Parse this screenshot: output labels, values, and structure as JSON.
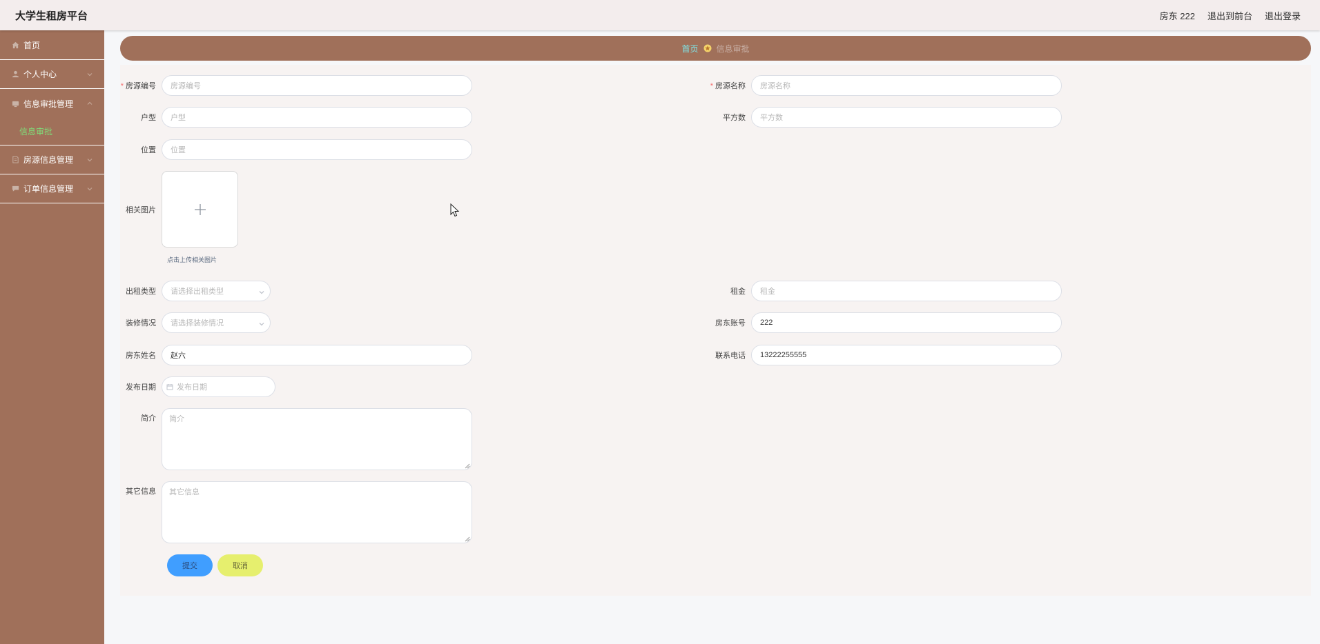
{
  "header": {
    "title": "大学生租房平台",
    "user_label": "房东 222",
    "to_front": "退出到前台",
    "logout": "退出登录"
  },
  "sidebar": {
    "items": [
      {
        "label": "首页",
        "icon": "home-icon"
      },
      {
        "label": "个人中心",
        "icon": "user-icon"
      },
      {
        "label": "信息审批管理",
        "icon": "monitor-icon",
        "expanded": true,
        "children": [
          {
            "label": "信息审批",
            "active": true
          }
        ]
      },
      {
        "label": "房源信息管理",
        "icon": "document-icon"
      },
      {
        "label": "订单信息管理",
        "icon": "chat-icon"
      }
    ]
  },
  "breadcrumb": {
    "home": "首页",
    "current": "信息审批"
  },
  "form": {
    "house_no": {
      "label": "房源编号",
      "placeholder": "房源编号",
      "required": true
    },
    "house_name": {
      "label": "房源名称",
      "placeholder": "房源名称",
      "required": true
    },
    "layout": {
      "label": "户型",
      "placeholder": "户型"
    },
    "area": {
      "label": "平方数",
      "placeholder": "平方数"
    },
    "location": {
      "label": "位置",
      "placeholder": "位置"
    },
    "photos": {
      "label": "相关图片",
      "tip": "点击上传相关图片"
    },
    "rent_type": {
      "label": "出租类型",
      "placeholder": "请选择出租类型"
    },
    "rent": {
      "label": "租金",
      "placeholder": "租金"
    },
    "decoration": {
      "label": "装修情况",
      "placeholder": "请选择装修情况"
    },
    "landlord_account": {
      "label": "房东账号",
      "value": "222"
    },
    "landlord_name": {
      "label": "房东姓名",
      "value": "赵六"
    },
    "phone": {
      "label": "联系电话",
      "value": "13222255555"
    },
    "publish_date": {
      "label": "发布日期",
      "placeholder": "发布日期"
    },
    "intro": {
      "label": "简介",
      "placeholder": "简介"
    },
    "other": {
      "label": "其它信息",
      "placeholder": "其它信息"
    },
    "submit_label": "提交",
    "cancel_label": "取消"
  },
  "colors": {
    "sidebar_bg": "#a0705a",
    "active_sub": "#7fe07a",
    "primary": "#409eff",
    "cancel": "#e6ef6e"
  }
}
